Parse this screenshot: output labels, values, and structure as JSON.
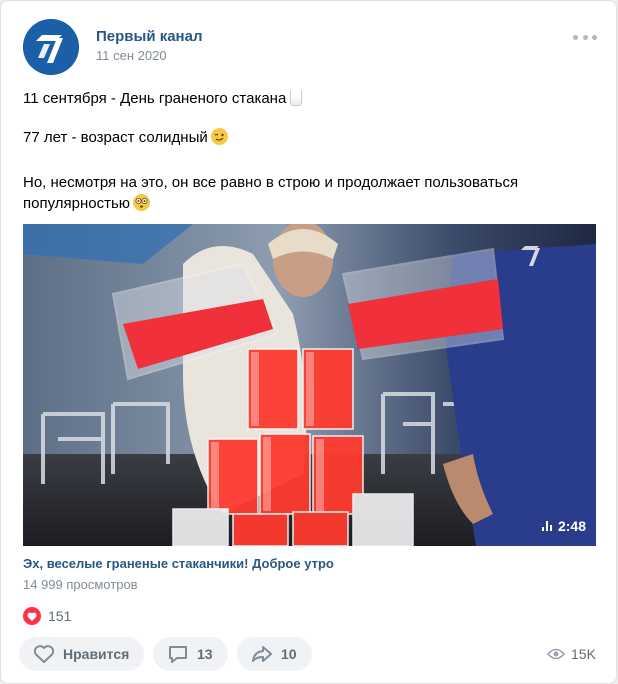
{
  "post": {
    "author": "Первый канал",
    "date": "11 сен 2020",
    "text_line1": "11 сентября - День граненого стакана",
    "text_line2": "77 лет - возраст солидный",
    "text_line3": "Но, несмотря на это, он все равно в строю и продолжает пользоваться",
    "text_line4": "популярностью"
  },
  "video": {
    "duration": "2:48",
    "title": "Эх, веселые граненые стаканчики! Доброе утро",
    "views": "14 999 просмотров"
  },
  "reactions": {
    "count": "151",
    "icon": "heart-icon",
    "color": "#ff3347"
  },
  "actions": {
    "like_label": "Нравится",
    "comments": "13",
    "shares": "10",
    "views": "15K"
  },
  "colors": {
    "link": "#2a5885",
    "muted": "#818c99",
    "button_bg": "#f0f2f5",
    "avatar_bg": "#1b5fa8"
  }
}
